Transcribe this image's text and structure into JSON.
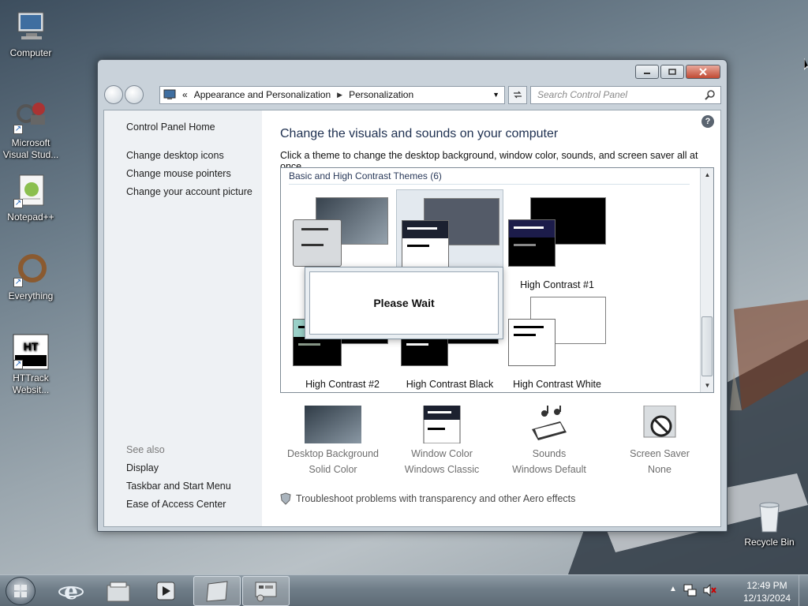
{
  "desktop": {
    "icons": [
      {
        "label": "Computer"
      },
      {
        "label": "Microsoft Visual Stud..."
      },
      {
        "label": "Notepad++"
      },
      {
        "label": "Everything"
      },
      {
        "label": "HTTrack Websit..."
      },
      {
        "label": "Recycle Bin"
      }
    ]
  },
  "window": {
    "address": {
      "overflow": "«",
      "crumb1": "Appearance and Personalization",
      "crumb2": "Personalization"
    },
    "search_placeholder": "Search Control Panel",
    "sidebar": {
      "home": "Control Panel Home",
      "links": [
        "Change desktop icons",
        "Change mouse pointers",
        "Change your account picture"
      ],
      "see_also_label": "See also",
      "see_also": [
        "Display",
        "Taskbar and Start Menu",
        "Ease of Access Center"
      ]
    },
    "main": {
      "title": "Change the visuals and sounds on your computer",
      "subtitle": "Click a theme to change the desktop background, window color, sounds, and screen saver all at once.",
      "group_header": "Basic and High Contrast Themes (6)",
      "themes": [
        {
          "label": ""
        },
        {
          "label": ""
        },
        {
          "label": "High Contrast #1"
        },
        {
          "label": "High Contrast #2"
        },
        {
          "label": "High Contrast Black"
        },
        {
          "label": "High Contrast White"
        }
      ],
      "wait_text": "Please Wait",
      "bottom": [
        {
          "title": "Desktop Background",
          "sub": "Solid Color"
        },
        {
          "title": "Window Color",
          "sub": "Windows Classic"
        },
        {
          "title": "Sounds",
          "sub": "Windows Default"
        },
        {
          "title": "Screen Saver",
          "sub": "None"
        }
      ],
      "troubleshoot": "Troubleshoot problems with transparency and other Aero effects"
    }
  },
  "taskbar": {
    "time": "12:49 PM",
    "date": "12/13/2024"
  },
  "colors": {
    "hc_black": "#000000",
    "hc_white": "#ffffff",
    "selection_bg": "#e3e9ef"
  }
}
